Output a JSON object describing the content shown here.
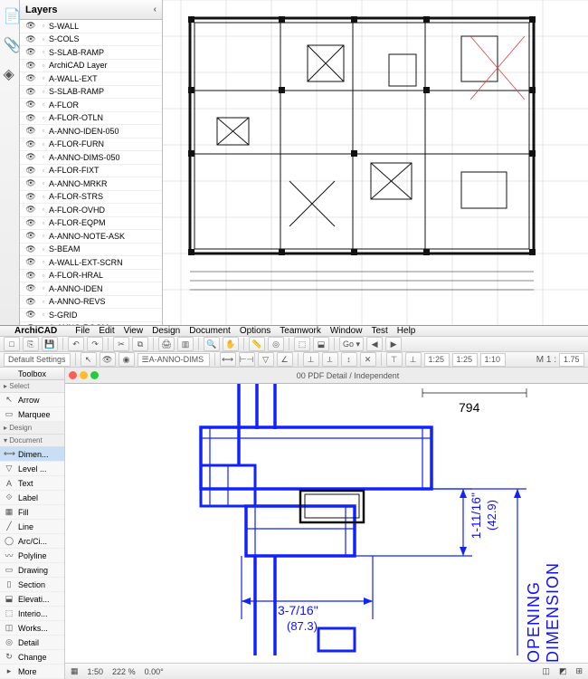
{
  "layers": {
    "title": "Layers",
    "items": [
      "S-WALL",
      "S-COLS",
      "S-SLAB-RAMP",
      "ArchiCAD Layer",
      "A-WALL-EXT",
      "S-SLAB-RAMP",
      "A-FLOR",
      "A-FLOR-OTLN",
      "A-ANNO-IDEN-050",
      "A-FLOR-FURN",
      "A-ANNO-DIMS-050",
      "A-FLOR-FIXT",
      "A-ANNO-MRKR",
      "A-FLOR-STRS",
      "A-FLOR-OVHD",
      "A-FLOR-EQPM",
      "A-ANNO-NOTE-ASK",
      "S-BEAM",
      "A-WALL-EXT-SCRN",
      "A-FLOR-HRAL",
      "A-ANNO-IDEN",
      "A-ANNO-REVS",
      "S-GRID",
      "A-ANNO-ROOM"
    ]
  },
  "menu": {
    "apple": "",
    "app": "ArchiCAD",
    "items": [
      "File",
      "Edit",
      "View",
      "Design",
      "Document",
      "Options",
      "Teamwork",
      "Window",
      "Test",
      "Help"
    ]
  },
  "toolbar": {
    "default_settings": "Default Settings",
    "layer_combo": "A-ANNO-DIMS",
    "scale_a": "1:25",
    "scale_b": "1:25",
    "scale_c": "1:10",
    "m_label": "M 1 :",
    "m_val": "1.75"
  },
  "toolbox": {
    "title": "Toolbox",
    "select": "Select",
    "arrow": "Arrow",
    "marquee": "Marquee",
    "groups": {
      "design": "Design",
      "document": "Document"
    },
    "items": [
      "Dimen...",
      "Level ...",
      "Text",
      "Label",
      "Fill",
      "Line",
      "Arc/Ci...",
      "Polyline",
      "Drawing",
      "Section",
      "Elevati...",
      "Interio...",
      "Works...",
      "Detail",
      "Change",
      "More"
    ]
  },
  "tab": {
    "title": "00 PDF Detail / Independent"
  },
  "status": {
    "scale": "1:50",
    "zoom": "222 %",
    "angle": "0.00°"
  },
  "detail": {
    "dim_top": "794",
    "dim_w": "3-7/16\"",
    "dim_w_mm": "(87.3)",
    "dim_h": "1-11/16\"",
    "dim_h_mm": "(42.9)",
    "opening": "OPENING DIMENSION"
  }
}
